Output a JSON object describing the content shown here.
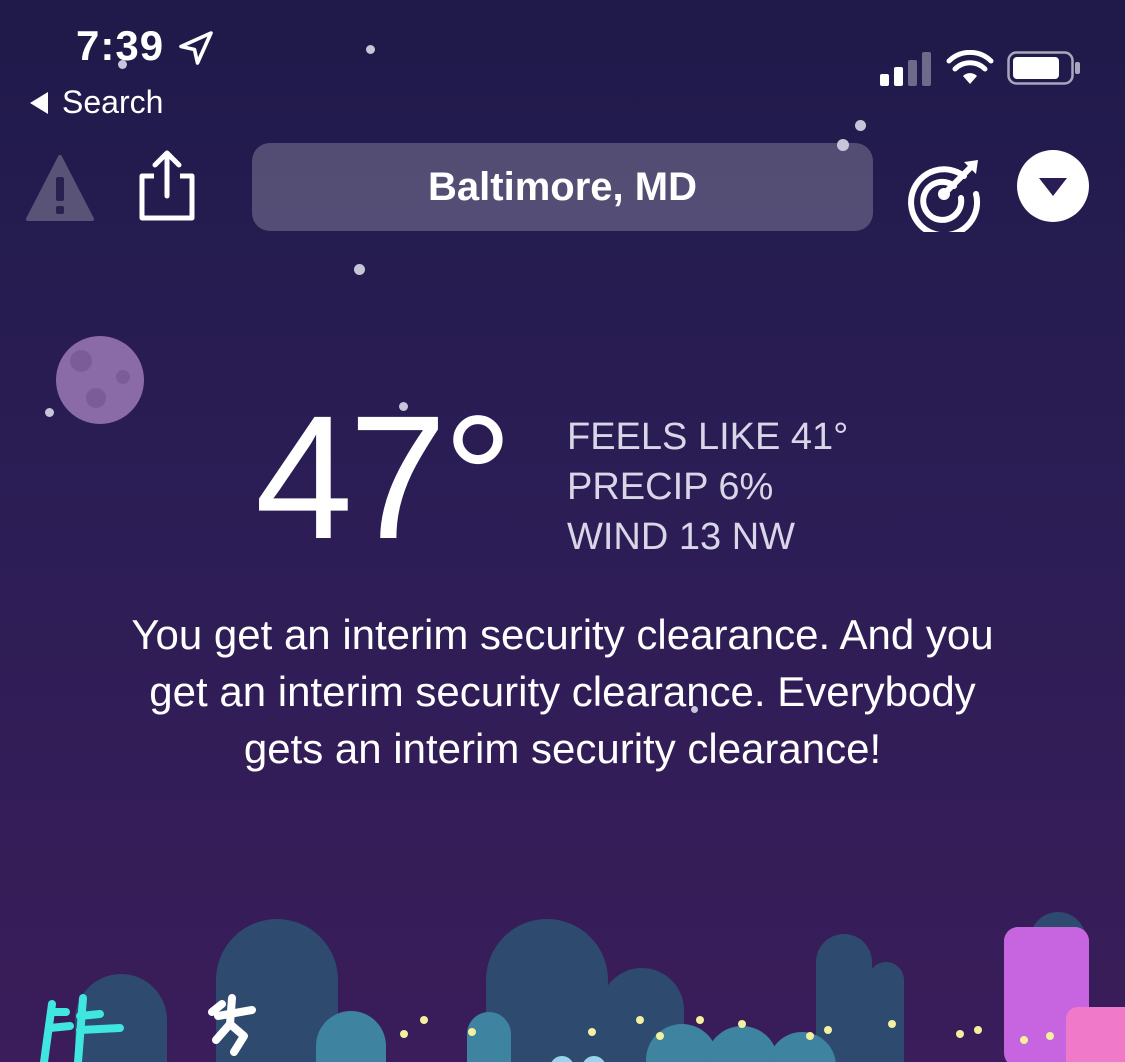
{
  "status_bar": {
    "time": "7:39",
    "back_label": "Search"
  },
  "toolbar": {
    "location": "Baltimore, MD",
    "icons": [
      "warning-icon",
      "share-icon",
      "radar-icon",
      "dropdown-icon"
    ]
  },
  "current": {
    "temperature": "47°",
    "feels_like": "FEELS LIKE 41°",
    "precip": "PRECIP 6%",
    "wind": "WIND 13 NW"
  },
  "quote": "You get an interim security clearance. And you get an interim security clearance. Everybody gets an interim security clearance!",
  "colors": {
    "bg_top": "#1f1a4a",
    "bg_bottom": "#3a1d5a",
    "building": "#2e4a6e",
    "accent_pink": "#c765e0",
    "accent_cyan": "#40e6e0"
  }
}
